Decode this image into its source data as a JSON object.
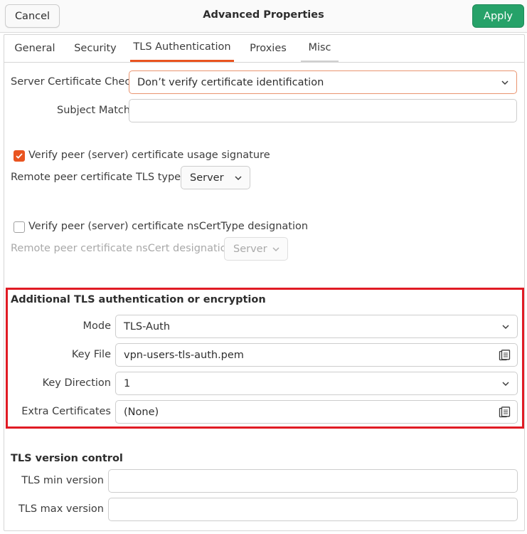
{
  "header": {
    "title": "Advanced Properties",
    "cancel_label": "Cancel",
    "apply_label": "Apply"
  },
  "tabs": [
    {
      "label": "General"
    },
    {
      "label": "Security"
    },
    {
      "label": "TLS Authentication",
      "active": true
    },
    {
      "label": "Proxies"
    },
    {
      "label": "Misc"
    }
  ],
  "server_cert": {
    "check_label": "Server Certificate Check",
    "check_value": "Don’t verify certificate identification",
    "subject_match_label": "Subject Match",
    "subject_match_value": ""
  },
  "peer_usage": {
    "checkbox_label": "Verify peer (server) certificate usage signature",
    "checked": true,
    "tls_type_label": "Remote peer certificate TLS type",
    "tls_type_value": "Server"
  },
  "peer_nscert": {
    "checkbox_label": "Verify peer (server) certificate nsCertType designation",
    "checked": false,
    "designation_label": "Remote peer certificate nsCert designation",
    "designation_value": "Server"
  },
  "additional_tls": {
    "title": "Additional TLS authentication or encryption",
    "mode_label": "Mode",
    "mode_value": "TLS-Auth",
    "key_file_label": "Key File",
    "key_file_value": "vpn-users-tls-auth.pem",
    "key_direction_label": "Key Direction",
    "key_direction_value": "1",
    "extra_certs_label": "Extra Certificates",
    "extra_certs_value": "(None)"
  },
  "tls_version": {
    "title": "TLS version control",
    "min_label": "TLS min version",
    "min_value": "",
    "max_label": "TLS max version",
    "max_value": ""
  },
  "colors": {
    "accent": "#e95420",
    "apply_green": "#26a269",
    "highlight_red": "#e01b24"
  }
}
